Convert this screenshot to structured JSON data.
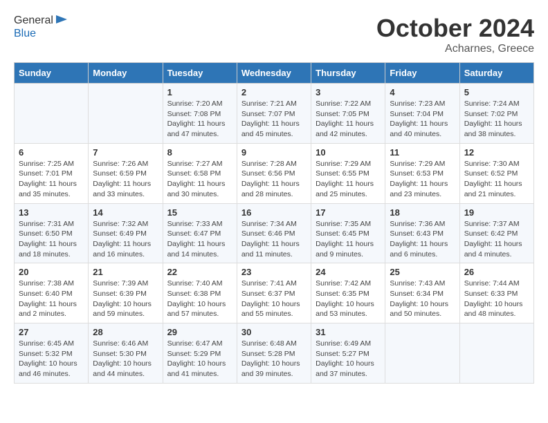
{
  "header": {
    "logo_line1": "General",
    "logo_line2": "Blue",
    "month_title": "October 2024",
    "location": "Acharnes, Greece"
  },
  "days_of_week": [
    "Sunday",
    "Monday",
    "Tuesday",
    "Wednesday",
    "Thursday",
    "Friday",
    "Saturday"
  ],
  "weeks": [
    [
      {
        "day": "",
        "detail": ""
      },
      {
        "day": "",
        "detail": ""
      },
      {
        "day": "1",
        "detail": "Sunrise: 7:20 AM\nSunset: 7:08 PM\nDaylight: 11 hours and 47 minutes."
      },
      {
        "day": "2",
        "detail": "Sunrise: 7:21 AM\nSunset: 7:07 PM\nDaylight: 11 hours and 45 minutes."
      },
      {
        "day": "3",
        "detail": "Sunrise: 7:22 AM\nSunset: 7:05 PM\nDaylight: 11 hours and 42 minutes."
      },
      {
        "day": "4",
        "detail": "Sunrise: 7:23 AM\nSunset: 7:04 PM\nDaylight: 11 hours and 40 minutes."
      },
      {
        "day": "5",
        "detail": "Sunrise: 7:24 AM\nSunset: 7:02 PM\nDaylight: 11 hours and 38 minutes."
      }
    ],
    [
      {
        "day": "6",
        "detail": "Sunrise: 7:25 AM\nSunset: 7:01 PM\nDaylight: 11 hours and 35 minutes."
      },
      {
        "day": "7",
        "detail": "Sunrise: 7:26 AM\nSunset: 6:59 PM\nDaylight: 11 hours and 33 minutes."
      },
      {
        "day": "8",
        "detail": "Sunrise: 7:27 AM\nSunset: 6:58 PM\nDaylight: 11 hours and 30 minutes."
      },
      {
        "day": "9",
        "detail": "Sunrise: 7:28 AM\nSunset: 6:56 PM\nDaylight: 11 hours and 28 minutes."
      },
      {
        "day": "10",
        "detail": "Sunrise: 7:29 AM\nSunset: 6:55 PM\nDaylight: 11 hours and 25 minutes."
      },
      {
        "day": "11",
        "detail": "Sunrise: 7:29 AM\nSunset: 6:53 PM\nDaylight: 11 hours and 23 minutes."
      },
      {
        "day": "12",
        "detail": "Sunrise: 7:30 AM\nSunset: 6:52 PM\nDaylight: 11 hours and 21 minutes."
      }
    ],
    [
      {
        "day": "13",
        "detail": "Sunrise: 7:31 AM\nSunset: 6:50 PM\nDaylight: 11 hours and 18 minutes."
      },
      {
        "day": "14",
        "detail": "Sunrise: 7:32 AM\nSunset: 6:49 PM\nDaylight: 11 hours and 16 minutes."
      },
      {
        "day": "15",
        "detail": "Sunrise: 7:33 AM\nSunset: 6:47 PM\nDaylight: 11 hours and 14 minutes."
      },
      {
        "day": "16",
        "detail": "Sunrise: 7:34 AM\nSunset: 6:46 PM\nDaylight: 11 hours and 11 minutes."
      },
      {
        "day": "17",
        "detail": "Sunrise: 7:35 AM\nSunset: 6:45 PM\nDaylight: 11 hours and 9 minutes."
      },
      {
        "day": "18",
        "detail": "Sunrise: 7:36 AM\nSunset: 6:43 PM\nDaylight: 11 hours and 6 minutes."
      },
      {
        "day": "19",
        "detail": "Sunrise: 7:37 AM\nSunset: 6:42 PM\nDaylight: 11 hours and 4 minutes."
      }
    ],
    [
      {
        "day": "20",
        "detail": "Sunrise: 7:38 AM\nSunset: 6:40 PM\nDaylight: 11 hours and 2 minutes."
      },
      {
        "day": "21",
        "detail": "Sunrise: 7:39 AM\nSunset: 6:39 PM\nDaylight: 10 hours and 59 minutes."
      },
      {
        "day": "22",
        "detail": "Sunrise: 7:40 AM\nSunset: 6:38 PM\nDaylight: 10 hours and 57 minutes."
      },
      {
        "day": "23",
        "detail": "Sunrise: 7:41 AM\nSunset: 6:37 PM\nDaylight: 10 hours and 55 minutes."
      },
      {
        "day": "24",
        "detail": "Sunrise: 7:42 AM\nSunset: 6:35 PM\nDaylight: 10 hours and 53 minutes."
      },
      {
        "day": "25",
        "detail": "Sunrise: 7:43 AM\nSunset: 6:34 PM\nDaylight: 10 hours and 50 minutes."
      },
      {
        "day": "26",
        "detail": "Sunrise: 7:44 AM\nSunset: 6:33 PM\nDaylight: 10 hours and 48 minutes."
      }
    ],
    [
      {
        "day": "27",
        "detail": "Sunrise: 6:45 AM\nSunset: 5:32 PM\nDaylight: 10 hours and 46 minutes."
      },
      {
        "day": "28",
        "detail": "Sunrise: 6:46 AM\nSunset: 5:30 PM\nDaylight: 10 hours and 44 minutes."
      },
      {
        "day": "29",
        "detail": "Sunrise: 6:47 AM\nSunset: 5:29 PM\nDaylight: 10 hours and 41 minutes."
      },
      {
        "day": "30",
        "detail": "Sunrise: 6:48 AM\nSunset: 5:28 PM\nDaylight: 10 hours and 39 minutes."
      },
      {
        "day": "31",
        "detail": "Sunrise: 6:49 AM\nSunset: 5:27 PM\nDaylight: 10 hours and 37 minutes."
      },
      {
        "day": "",
        "detail": ""
      },
      {
        "day": "",
        "detail": ""
      }
    ]
  ]
}
